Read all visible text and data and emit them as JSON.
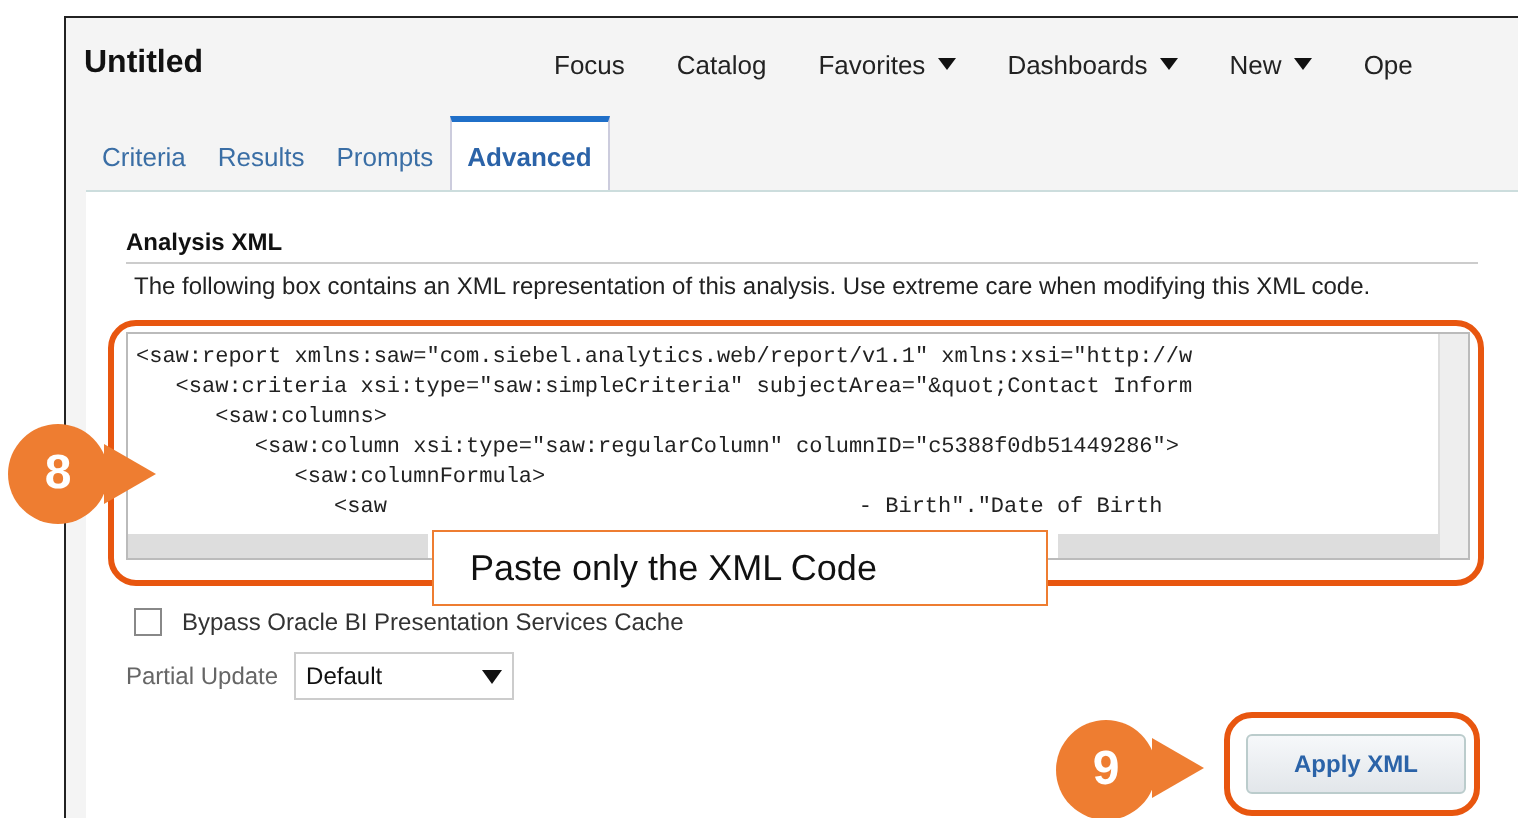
{
  "window": {
    "title": "Untitled"
  },
  "menu": [
    {
      "label": "Focus",
      "dropdown": false
    },
    {
      "label": "Catalog",
      "dropdown": false
    },
    {
      "label": "Favorites",
      "dropdown": true
    },
    {
      "label": "Dashboards",
      "dropdown": true
    },
    {
      "label": "New",
      "dropdown": true
    },
    {
      "label": "Ope",
      "dropdown": false
    }
  ],
  "tabs": [
    {
      "label": "Criteria",
      "selected": false
    },
    {
      "label": "Results",
      "selected": false
    },
    {
      "label": "Prompts",
      "selected": false
    },
    {
      "label": "Advanced",
      "selected": true
    }
  ],
  "section": {
    "title": "Analysis XML",
    "description": "The following box contains an XML representation of this analysis. Use extreme care when modifying this XML code."
  },
  "xml_lines": [
    [
      "<saw:report xmlns:saw=\"com.siebel.analytics.web/report/v1.1\" xmlns:xsi=\"http://w"
    ],
    [
      "   <saw:criteria xsi:type=\"saw:simpleCriteria\" subjectArea=\"&quot;Contact Inform"
    ],
    [
      "      <saw:columns>"
    ],
    [
      "         <saw:column xsi:type=\"saw:regularColumn\" columnID=\"c5388f0db51449286\">"
    ],
    [
      "            <saw:columnFormula>"
    ],
    [
      "               <saw",
      "- Birth\".\"Date of Birth"
    ]
  ],
  "bypass_cache": {
    "label": "Bypass Oracle BI Presentation Services Cache",
    "checked": false
  },
  "partial_update": {
    "label": "Partial Update",
    "value": "Default"
  },
  "apply_button": "Apply XML",
  "annotations": {
    "step_a": "8",
    "step_b": "9",
    "callout": "Paste only the XML Code"
  }
}
